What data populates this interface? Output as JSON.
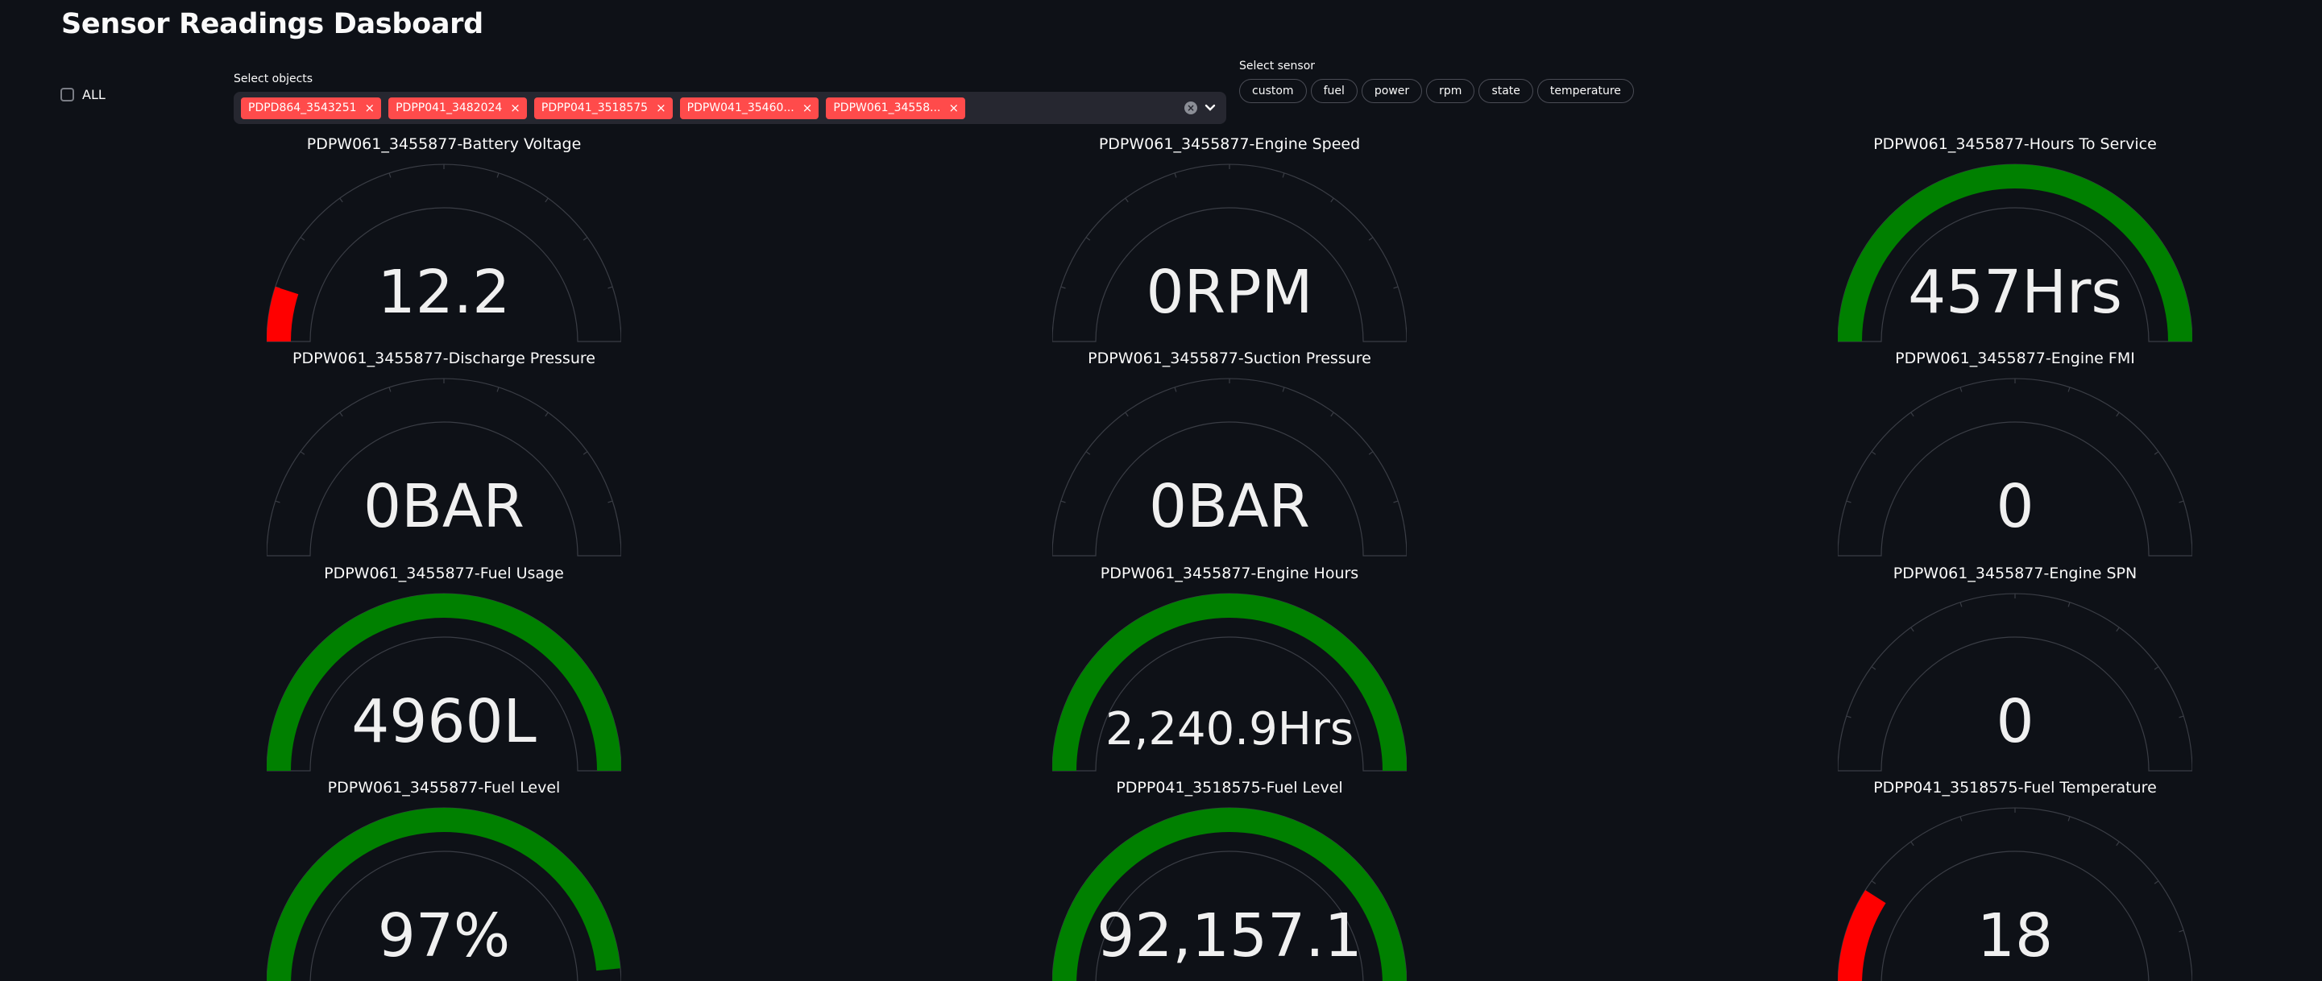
{
  "title": "Sensor Readings Dasboard",
  "all_checkbox": {
    "label": "ALL",
    "checked": false
  },
  "objects": {
    "label": "Select objects",
    "selected": [
      "PDPD864_3543251",
      "PDPP041_3482024",
      "PDPP041_3518575",
      "PDPW041_35460...",
      "PDPW061_34558..."
    ]
  },
  "sensor": {
    "label": "Select sensor",
    "options": [
      "custom",
      "fuel",
      "power",
      "rpm",
      "state",
      "temperature"
    ]
  },
  "colors": {
    "green": "#008000",
    "red": "#ff0000",
    "background": "#0e1117",
    "accent": "#ff4b4b"
  },
  "gauges": [
    {
      "title": "PDPW061_3455877-Battery Voltage",
      "value": "12.2",
      "fill": 0.1,
      "color": "#ff0000"
    },
    {
      "title": "PDPW061_3455877-Engine Speed",
      "value": "0RPM",
      "fill": 0,
      "color": "#008000"
    },
    {
      "title": "PDPW061_3455877-Hours To Service",
      "value": "457Hrs",
      "fill": 1.0,
      "color": "#008000"
    },
    {
      "title": "PDPW061_3455877-Discharge Pressure",
      "value": "0BAR",
      "fill": 0,
      "color": "#008000"
    },
    {
      "title": "PDPW061_3455877-Suction Pressure",
      "value": "0BAR",
      "fill": 0,
      "color": "#008000"
    },
    {
      "title": "PDPW061_3455877-Engine FMI",
      "value": "0",
      "fill": 0,
      "color": "#008000"
    },
    {
      "title": "PDPW061_3455877-Fuel Usage",
      "value": "4960L",
      "fill": 1.0,
      "color": "#008000"
    },
    {
      "title": "PDPW061_3455877-Engine Hours",
      "value": "2,240.9Hrs",
      "fill": 1.0,
      "color": "#008000"
    },
    {
      "title": "PDPW061_3455877-Engine SPN",
      "value": "0",
      "fill": 0,
      "color": "#008000"
    },
    {
      "title": "PDPW061_3455877-Fuel Level",
      "value": "97%",
      "fill": 0.97,
      "color": "#008000"
    },
    {
      "title": "PDPP041_3518575-Fuel Level",
      "value": "92,157.1",
      "fill": 1.0,
      "color": "#008000"
    },
    {
      "title": "PDPP041_3518575-Fuel Temperature",
      "value": "18",
      "fill": 0.18,
      "color": "#ff0000"
    }
  ]
}
